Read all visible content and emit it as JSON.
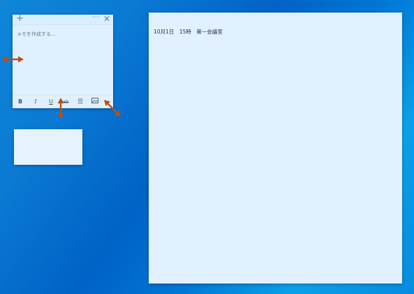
{
  "small_note": {
    "add_icon": "+",
    "more_icon": "···",
    "close_icon": "✕",
    "placeholder": "メモを作成する...",
    "toolbar": {
      "bold": "B",
      "italic": "I",
      "underline": "U",
      "strikethrough": "ab",
      "list_icon": "☰",
      "image_icon": "image-icon"
    }
  },
  "large_note": {
    "text": "10月1日　15時　第一会議室"
  },
  "resize_handles": [
    {
      "name": "left-resize-arrow",
      "color": "#b94f14"
    },
    {
      "name": "bottom-resize-arrow",
      "color": "#b94f14"
    },
    {
      "name": "corner-resize-arrow",
      "color": "#b94f14"
    }
  ]
}
